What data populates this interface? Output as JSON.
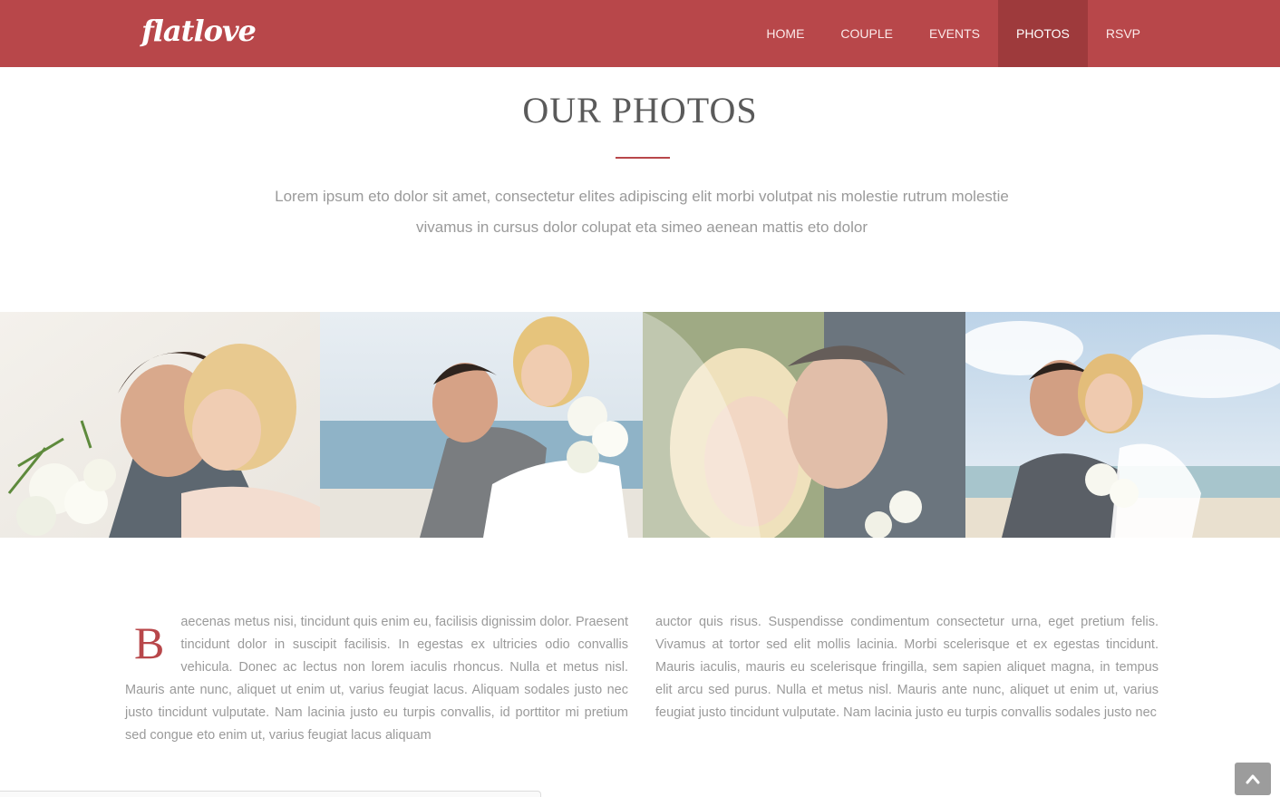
{
  "header": {
    "logo_text": "flatlove",
    "nav": [
      {
        "label": "HOME",
        "active": false
      },
      {
        "label": "COUPLE",
        "active": false
      },
      {
        "label": "EVENTS",
        "active": false
      },
      {
        "label": "PHOTOS",
        "active": true
      },
      {
        "label": "RSVP",
        "active": false
      }
    ]
  },
  "photos_section": {
    "title": "OUR PHOTOS",
    "intro_line1": "Lorem ipsum eto dolor sit amet, consectetur elites adipiscing elit morbi volutpat nis molestie rutrum molestie",
    "intro_line2": "vivamus in cursus dolor colupat eta simeo aenean mattis eto dolor"
  },
  "gallery": [
    {
      "subject": "embracing-couple-with-bouquet"
    },
    {
      "subject": "groom-carrying-bride-on-beach"
    },
    {
      "subject": "couple-under-veil"
    },
    {
      "subject": "couple-smiling-by-sea"
    }
  ],
  "article": {
    "dropcap": "B",
    "left_text": "aecenas metus nisi, tincidunt quis enim eu, facilisis dignissim dolor. Praesent tincidunt dolor in suscipit facilisis. In egestas ex ultricies odio convallis vehicula. Donec ac lectus non lorem iaculis rhoncus. Nulla et metus nisl. Mauris ante nunc, aliquet ut enim ut, varius feugiat lacus. Aliquam sodales justo nec justo tincidunt vulputate. Nam lacinia justo eu turpis convallis, id porttitor mi pretium sed congue eto enim ut, varius feugiat lacus aliquam",
    "right_text": "auctor quis risus. Suspendisse condimentum consectetur urna, eget pretium felis. Vivamus at tortor sed elit mollis lacinia. Morbi scelerisque et ex egestas tincidunt. Mauris iaculis, mauris eu scelerisque fringilla, sem sapien aliquet magna, in tempus elit arcu sed purus. Nulla et metus nisl. Mauris ante nunc, aliquet ut enim ut, varius feugiat justo tincidunt vulputate. Nam lacinia justo eu turpis convallis sodales justo nec"
  },
  "colors": {
    "brand": "#b8474a",
    "nav_active": "#9e3a3c",
    "text_muted": "#9a9a9a",
    "title": "#5a5a5a"
  },
  "icons": {
    "back_to_top": "chevron-up-icon"
  }
}
